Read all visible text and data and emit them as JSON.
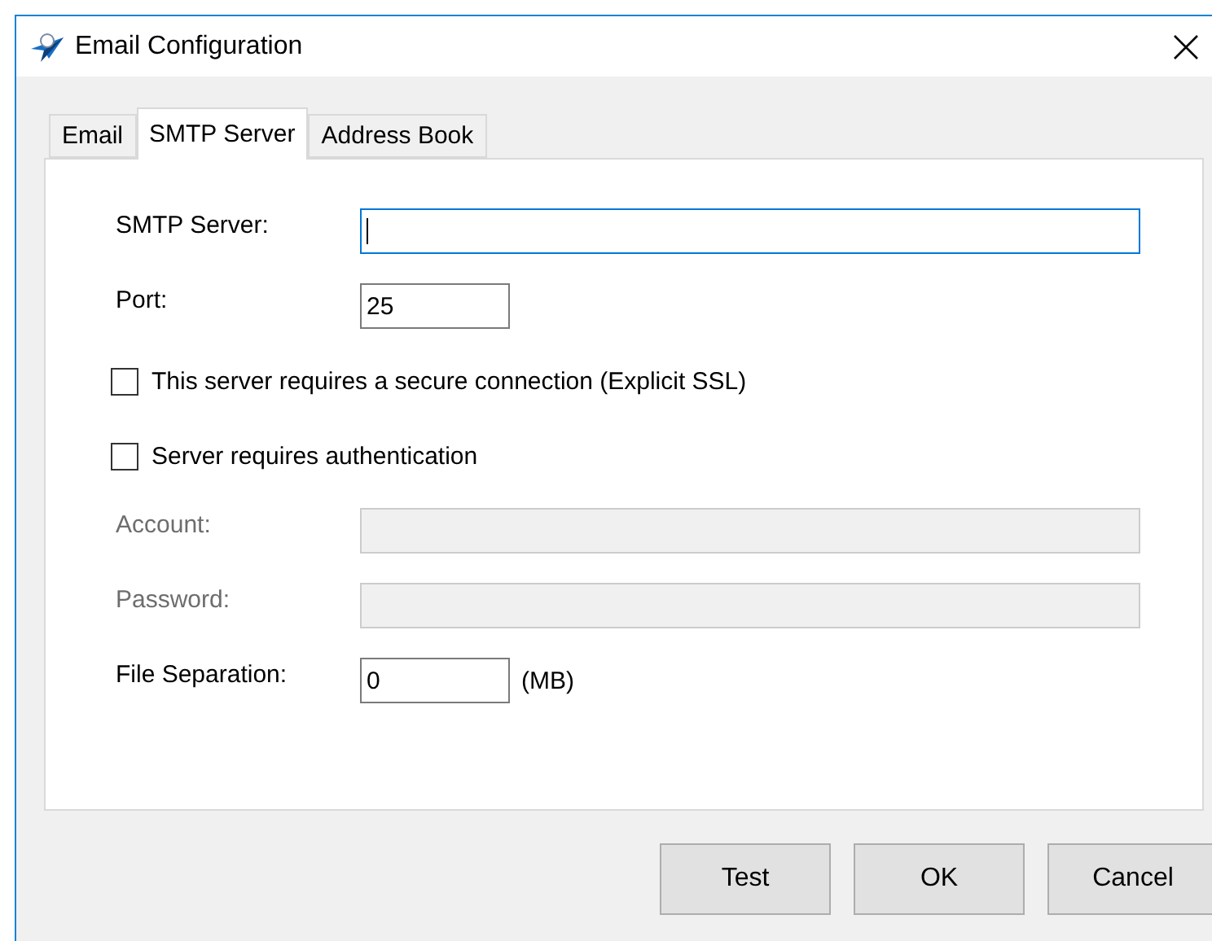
{
  "window": {
    "title": "Email Configuration"
  },
  "tabs": [
    {
      "label": "Email",
      "selected": false
    },
    {
      "label": "SMTP Server",
      "selected": true
    },
    {
      "label": "Address Book",
      "selected": false
    }
  ],
  "form": [
    {
      "kind": "wide-field",
      "label": "SMTP Server:",
      "focused": true,
      "disabled": false
    },
    {
      "kind": "short-field",
      "label": "Port:",
      "value": "25",
      "focused": false,
      "disabled": false
    },
    {
      "kind": "checkbox",
      "label": "This server requires a secure connection (Explicit SSL)",
      "checked": false
    },
    {
      "kind": "checkbox",
      "label": "Server requires authentication",
      "checked": false
    },
    {
      "kind": "wide-field",
      "label": "Account:",
      "focused": false,
      "disabled": true
    },
    {
      "kind": "wide-field",
      "label": "Password:",
      "focused": false,
      "disabled": true
    },
    {
      "kind": "short-field",
      "label": "File Separation:",
      "value": "0",
      "unit": "(MB)",
      "focused": false,
      "disabled": false
    }
  ],
  "buttons": [
    "Test",
    "OK",
    "Cancel"
  ]
}
